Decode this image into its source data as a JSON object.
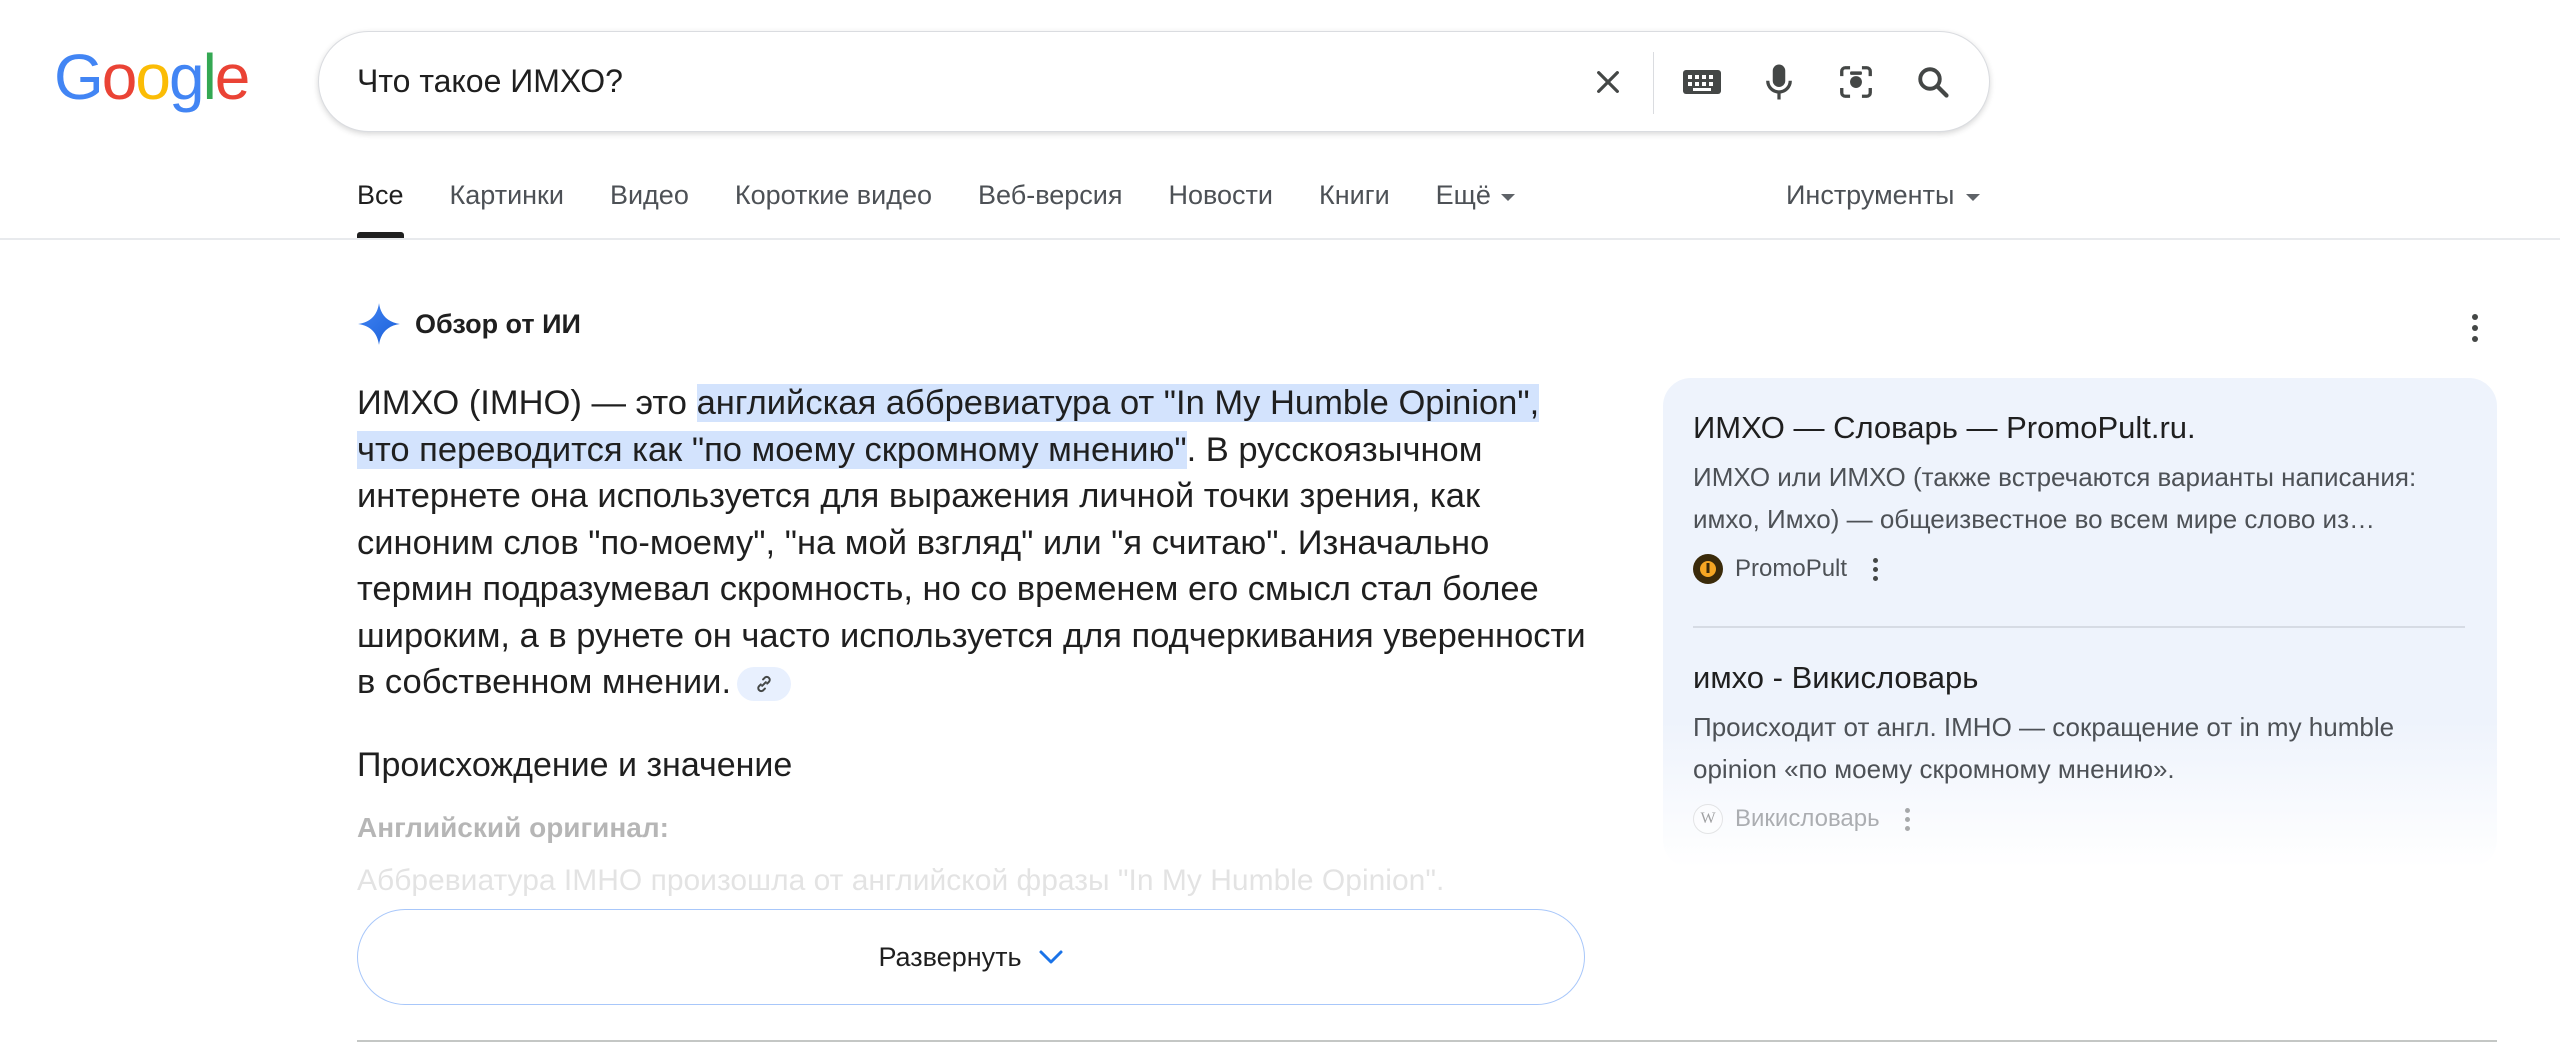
{
  "logo": {
    "letters": [
      "G",
      "o",
      "o",
      "g",
      "l",
      "e"
    ]
  },
  "search": {
    "query": "Что такое ИМХО?"
  },
  "icons": {
    "clear": "close-icon",
    "keyboard": "keyboard-icon",
    "voice": "microphone-icon",
    "lens": "camera-lens-icon",
    "search": "search-icon",
    "ai": "sparkle-icon",
    "more": "more-vert-icon",
    "link": "link-icon",
    "expand": "chevron-down-icon"
  },
  "tabs": [
    {
      "label": "Все",
      "active": true
    },
    {
      "label": "Картинки"
    },
    {
      "label": "Видео"
    },
    {
      "label": "Короткие видео"
    },
    {
      "label": "Веб-версия"
    },
    {
      "label": "Новости"
    },
    {
      "label": "Книги"
    },
    {
      "label": "Ещё"
    }
  ],
  "tools_label": "Инструменты",
  "ai_overview": {
    "title": "Обзор от ИИ",
    "intro": "ИМХО (IMHO) — это ",
    "highlight": "английская аббревиатура от \"In My Humble Opinion\", что переводится как \"по моему скромному мнению\"",
    "rest": ". В русскоязычном интернете она используется для выражения личной точки зрения, как синоним слов \"по-моему\", \"на мой взгляд\" или \"я считаю\". Изначально термин подразумевал скромность, но со временем его смысл стал более широким, а в рунете он часто используется для подчеркивания уверенности в собственном мнении.",
    "section_heading": "Происхождение и значение",
    "faded_heading": "Английский оригинал:",
    "faded_text": "Аббревиатура IMHO произошла от английской фразы \"In My Humble Opinion\".",
    "expand_label": "Развернуть"
  },
  "sources": [
    {
      "title": "ИМХО — Словарь — PromoPult.ru.",
      "snippet": "ИМХО или ИМХО (также встречаются варианты написания: имхо, Имхо) — общеизвестное во всем мире слово из…",
      "site": "PromoPult",
      "favicon_color": "#3a2a0a"
    },
    {
      "title": "имхо - Викисловарь",
      "snippet": "Происходит от англ. IMHO — сокращение от in my humble opinion «по моему скромному мнению».",
      "site": "Викисловарь",
      "favicon_letter": "W"
    }
  ],
  "colors": {
    "accent_blue": "#1a73e8",
    "highlight": "#d3e3fd",
    "panel_bg": "#eef3fc"
  }
}
